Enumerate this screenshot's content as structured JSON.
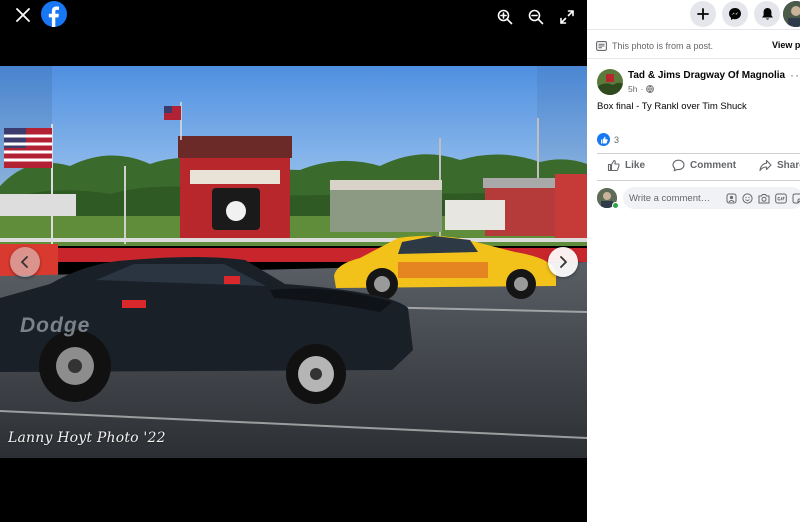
{
  "viewer": {
    "icons": {
      "close": "close-icon",
      "logo": "facebook-logo",
      "zoom_in": "zoom-in-icon",
      "zoom_out": "zoom-out-icon",
      "fullscreen": "fullscreen-icon",
      "prev": "chevron-left-icon",
      "next": "chevron-right-icon"
    },
    "photo": {
      "watermark": "Lanny Hoyt Photo '22",
      "car_brand_text": "Dodge"
    }
  },
  "panel": {
    "header": {
      "icons": [
        "plus-icon",
        "messenger-icon",
        "bell-icon",
        "profile-avatar"
      ]
    },
    "from_post_notice": "This photo is from a post.",
    "view_post_label": "View post",
    "page_name": "Tad & Jims Dragway Of Magnolia",
    "post_time": "5h",
    "more_label": "···",
    "caption": "Box final - Ty Rankl over Tim Shuck",
    "reaction_count": "3",
    "actions": {
      "like": "Like",
      "comment": "Comment",
      "share": "Share"
    },
    "comment_placeholder": "Write a comment…"
  },
  "colors": {
    "facebook_blue": "#1877f2",
    "secondary_text": "#65676b",
    "primary_text": "#050505",
    "online_green": "#31a24c"
  }
}
